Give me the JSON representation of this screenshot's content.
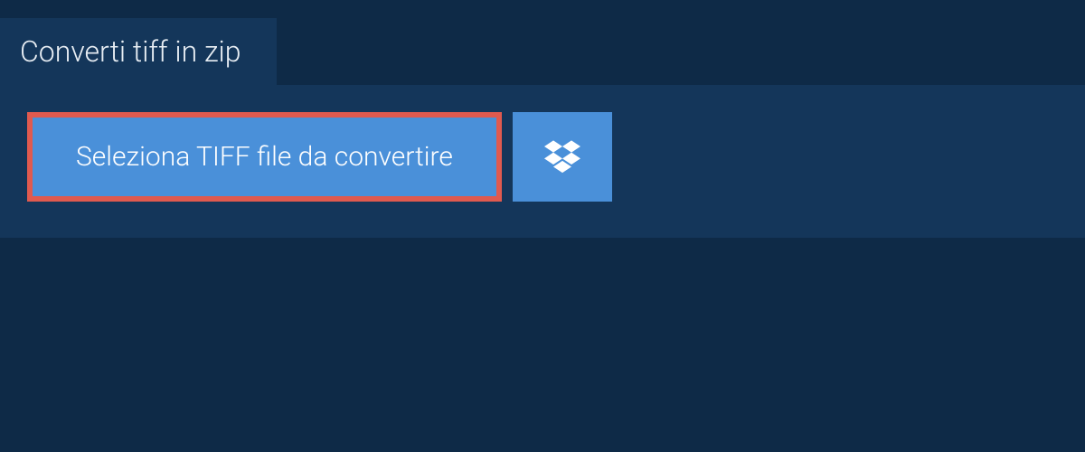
{
  "tab": {
    "title": "Converti tiff in zip"
  },
  "actions": {
    "select_label": "Seleziona TIFF file da convertire"
  }
}
